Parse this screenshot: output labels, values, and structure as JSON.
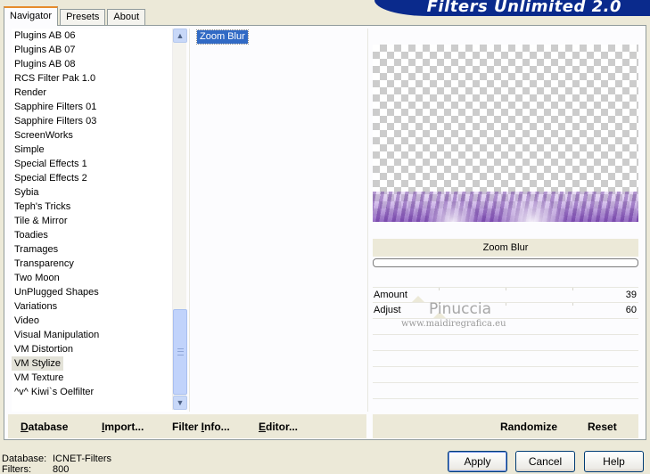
{
  "tabs": [
    "Navigator",
    "Presets",
    "About"
  ],
  "brand": "Filters Unlimited 2.0",
  "categories": [
    "Plugins AB 06",
    "Plugins AB 07",
    "Plugins AB 08",
    "RCS Filter Pak 1.0",
    "Render",
    "Sapphire Filters 01",
    "Sapphire Filters 03",
    "ScreenWorks",
    "Simple",
    "Special Effects 1",
    "Special Effects 2",
    "Sybia",
    "Teph's Tricks",
    "Tile & Mirror",
    "Toadies",
    "Tramages",
    "Transparency",
    "Two Moon",
    "UnPlugged Shapes",
    "Variations",
    "Video",
    "Visual Manipulation",
    "VM Distortion",
    "VM Stylize",
    "VM Texture",
    "^v^ Kiwi`s Oelfilter"
  ],
  "selected_category": "VM Stylize",
  "filters": [
    "Zoom Blur"
  ],
  "selected_filter": "Zoom Blur",
  "filter_title": "Zoom Blur",
  "params": [
    {
      "label": "Amount",
      "value": "39",
      "level": 0.153
    },
    {
      "label": "Adjust",
      "value": "60",
      "level": 0.235
    }
  ],
  "watermark": {
    "name": "Pinuccia",
    "url": "www.maidiregrafica.eu"
  },
  "left_buttons": {
    "database": {
      "pre": "",
      "u": "D",
      "rest": "atabase"
    },
    "import": {
      "pre": "",
      "u": "I",
      "rest": "mport..."
    },
    "filter_info": {
      "pre": "Filter ",
      "u": "I",
      "rest": "nfo..."
    },
    "editor": {
      "pre": "",
      "u": "E",
      "rest": "ditor..."
    }
  },
  "right_buttons": {
    "randomize": "Randomize",
    "reset": "Reset"
  },
  "status": {
    "database_label": "Database:",
    "database_value": "ICNET-Filters",
    "filters_label": "Filters:",
    "filters_value": "800"
  },
  "dialog_buttons": {
    "apply": "Apply",
    "cancel": "Cancel",
    "help": "Help"
  }
}
